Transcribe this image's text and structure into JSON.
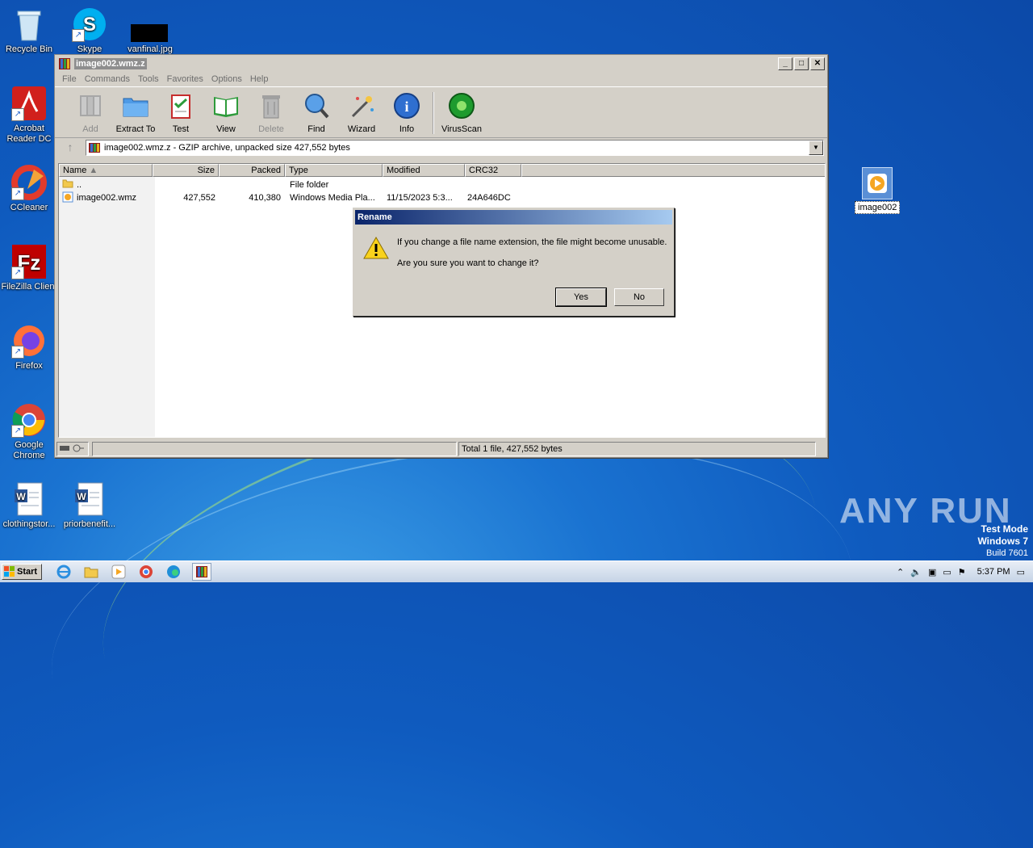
{
  "desktop": {
    "icons": [
      {
        "label": "Recycle Bin"
      },
      {
        "label": "Skype"
      },
      {
        "label": "vanfinal.jpg"
      },
      {
        "label": "Acrobat Reader DC"
      },
      {
        "label": "CCleaner"
      },
      {
        "label": "FileZilla Client"
      },
      {
        "label": "Firefox"
      },
      {
        "label": "Google Chrome"
      },
      {
        "label": "clothingstor..."
      },
      {
        "label": "priorbenefit..."
      }
    ],
    "right_icon_label": "image002"
  },
  "window": {
    "title": "image002.wmz.z",
    "menu": [
      "File",
      "Commands",
      "Tools",
      "Favorites",
      "Options",
      "Help"
    ],
    "toolbar": [
      {
        "label": "Add",
        "enabled": false
      },
      {
        "label": "Extract To",
        "enabled": true
      },
      {
        "label": "Test",
        "enabled": true
      },
      {
        "label": "View",
        "enabled": true
      },
      {
        "label": "Delete",
        "enabled": false
      },
      {
        "label": "Find",
        "enabled": true
      },
      {
        "label": "Wizard",
        "enabled": true
      },
      {
        "label": "Info",
        "enabled": true
      },
      {
        "label": "VirusScan",
        "enabled": true
      }
    ],
    "address": "image002.wmz.z - GZIP archive, unpacked size 427,552 bytes",
    "columns": [
      "Name",
      "Size",
      "Packed",
      "Type",
      "Modified",
      "CRC32"
    ],
    "rows": [
      {
        "name": "..",
        "size": "",
        "packed": "",
        "type": "File folder",
        "modified": "",
        "crc": ""
      },
      {
        "name": "image002.wmz",
        "size": "427,552",
        "packed": "410,380",
        "type": "Windows Media Pla...",
        "modified": "11/15/2023 5:3...",
        "crc": "24A646DC"
      }
    ],
    "status": "Total 1 file, 427,552 bytes"
  },
  "dialog": {
    "title": "Rename",
    "message1": "If you change a file name extension, the file might become unusable.",
    "message2": "Are you sure you want to change it?",
    "yes": "Yes",
    "no": "No"
  },
  "watermark": {
    "brand": "ANY RUN",
    "mode": "Test Mode",
    "os": "Windows 7",
    "build": "Build 7601"
  },
  "taskbar": {
    "start": "Start",
    "clock": "5:37 PM"
  }
}
